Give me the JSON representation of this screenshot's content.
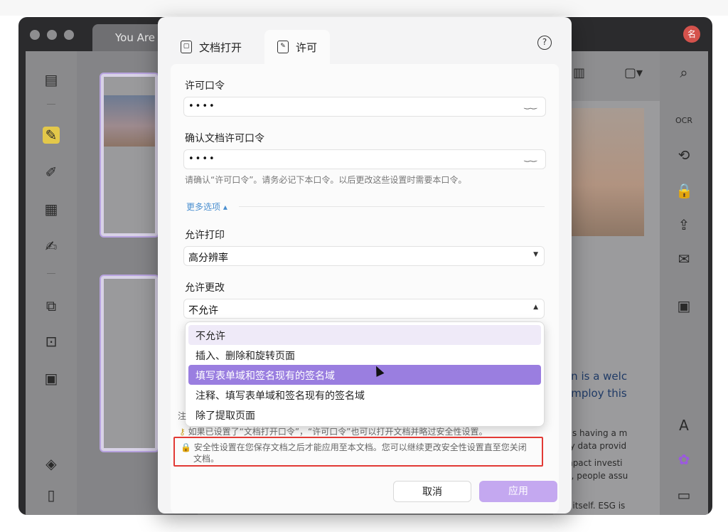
{
  "app": {
    "doc_tab": "You Are",
    "avatar": "名",
    "page_text": {
      "line1": "on is a welc",
      "line2": "employ this",
      "line3": ", is having a m",
      "line4": "by data provid",
      "line5": "mpact investi",
      "line6": "rt, people assu",
      "line7": "n itself. ESG is"
    }
  },
  "dialog": {
    "tabs": {
      "open": "文档打开",
      "permission": "许可"
    },
    "permission_password": {
      "label": "许可口令",
      "value": "••••"
    },
    "confirm_password": {
      "label": "确认文档许可口令",
      "value": "••••"
    },
    "hint": "请确认“许可口令”。请务必记下本口令。以后更改这些设置时需要本口令。",
    "more_options": "更多选项 ▴",
    "print": {
      "label": "允许打印",
      "selected": "高分辨率"
    },
    "changes": {
      "label": "允许更改",
      "selected": "不允许",
      "options": [
        "不允许",
        "插入、删除和旋转页面",
        "填写表单域和签名现有的签名域",
        "注释、填写表单域和签名现有的签名域",
        "除了提取页面"
      ]
    },
    "note_prefix": "注",
    "note_open_password": "如果已设置了“文档打开口令”，“许可口令”也可以打开文档并略过安全性设置。",
    "note_security_line1": "安全性设置在您保存文档之后才能应用至本文档。您可以继续更改安全性设置直至您关闭",
    "note_security_line2": "文档。",
    "buttons": {
      "cancel": "取消",
      "apply": "应用"
    }
  }
}
